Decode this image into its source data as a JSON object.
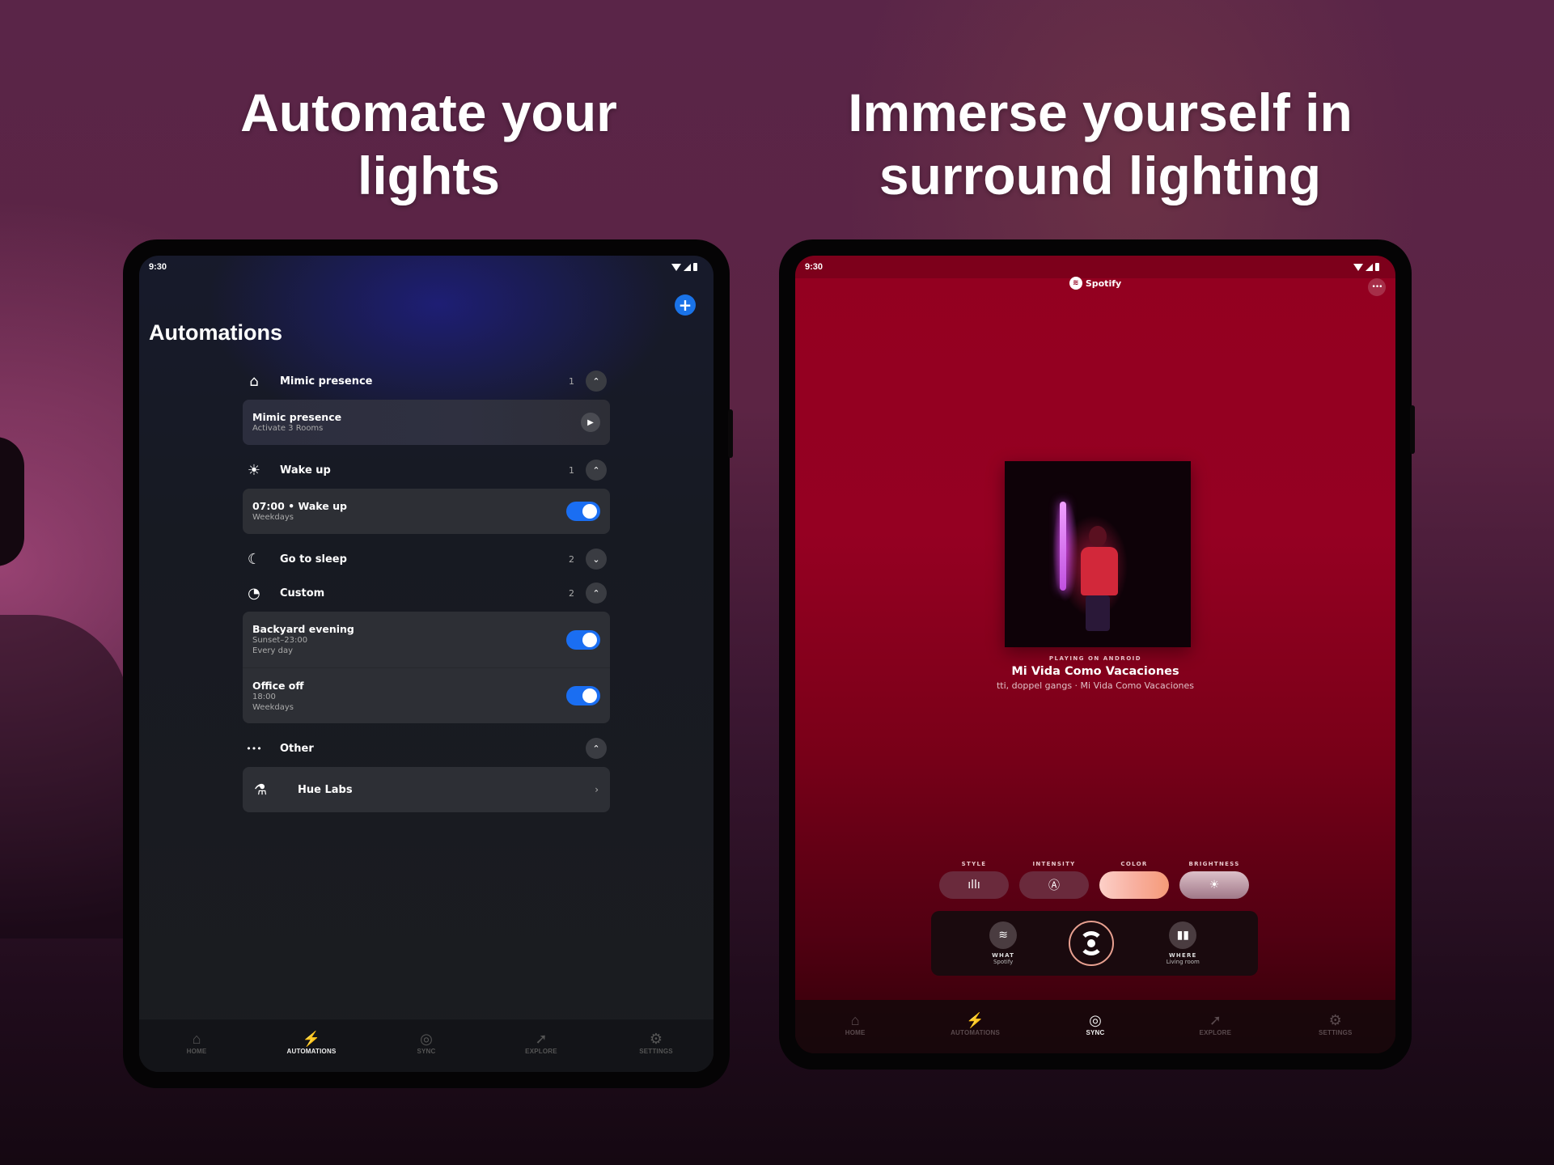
{
  "headlines": {
    "left": "Automate your lights",
    "right": "Immerse yourself in surround lighting"
  },
  "left_tablet": {
    "status": {
      "time": "9:30",
      "icons": [
        "wifi-icon",
        "signal-icon",
        "battery-icon"
      ]
    },
    "add_button": "+",
    "page_title": "Automations",
    "groups": [
      {
        "icon": "home-away-icon",
        "glyph": "⌂",
        "label": "Mimic presence",
        "count": "1",
        "expanded": true,
        "items": [
          {
            "title": "Mimic presence",
            "subtitle": [
              "Activate 3 Rooms"
            ],
            "control": "play"
          }
        ]
      },
      {
        "icon": "sunrise-icon",
        "glyph": "☀",
        "label": "Wake up",
        "count": "1",
        "expanded": true,
        "items": [
          {
            "title": "07:00 • Wake up",
            "subtitle": [
              "Weekdays"
            ],
            "control": "toggle",
            "on": true
          }
        ]
      },
      {
        "icon": "moon-sleep-icon",
        "glyph": "☾",
        "label": "Go to sleep",
        "count": "2",
        "expanded": false,
        "items": []
      },
      {
        "icon": "clock-icon",
        "glyph": "◔",
        "label": "Custom",
        "count": "2",
        "expanded": true,
        "items": [
          {
            "title": "Backyard evening",
            "subtitle": [
              "Sunset–23:00",
              "Every day"
            ],
            "control": "toggle",
            "on": true
          },
          {
            "title": "Office off",
            "subtitle": [
              "18:00",
              "Weekdays"
            ],
            "control": "toggle",
            "on": true
          }
        ]
      },
      {
        "icon": "more-dots-icon",
        "glyph": "•••",
        "label": "Other",
        "count": "",
        "expanded": true,
        "items": [
          {
            "title": "Hue Labs",
            "icon": "flask-icon",
            "control": "chevron"
          }
        ]
      }
    ],
    "chevron_up": "⌃",
    "chevron_down": "⌄",
    "play_glyph": "▶",
    "right_chevron": "›",
    "tabs": [
      {
        "label": "HOME",
        "icon": "home-icon",
        "glyph": "⌂",
        "active": false
      },
      {
        "label": "AUTOMATIONS",
        "icon": "lightning-icon",
        "glyph": "⚡",
        "active": true
      },
      {
        "label": "SYNC",
        "icon": "sync-icon",
        "glyph": "◎",
        "active": false
      },
      {
        "label": "EXPLORE",
        "icon": "rocket-icon",
        "glyph": "➚",
        "active": false
      },
      {
        "label": "SETTINGS",
        "icon": "gear-icon",
        "glyph": "⚙",
        "active": false
      }
    ]
  },
  "right_tablet": {
    "status": {
      "time": "9:30",
      "icons": [
        "wifi-icon",
        "signal-icon",
        "battery-icon"
      ]
    },
    "source_logo": "Spotify",
    "more_glyph": "•••",
    "now_playing": {
      "label": "PLAYING ON ANDROID",
      "title": "Mi Vida Como Vacaciones",
      "artist_line": "tti, doppel gangs · Mi Vida Como Vacaciones"
    },
    "controls": [
      {
        "label": "STYLE",
        "icon": "waveform-icon",
        "glyph": "ıllı"
      },
      {
        "label": "INTENSITY",
        "icon": "intensity-auto-icon",
        "glyph": "Ⓐ"
      },
      {
        "label": "COLOR",
        "icon": "color-gradient",
        "glyph": ""
      },
      {
        "label": "BRIGHTNESS",
        "icon": "sun-icon",
        "glyph": "☀"
      }
    ],
    "sync_panel": {
      "what": {
        "label": "WHAT",
        "value": "Spotify",
        "icon": "spotify-icon",
        "glyph": "≋"
      },
      "where": {
        "label": "WHERE",
        "value": "Living room",
        "icon": "lamps-icon",
        "glyph": "▮▮"
      }
    },
    "colors": {
      "accent_gradient": [
        "#fcd0c8",
        "#f59a78"
      ],
      "background": "#930020"
    },
    "tabs": [
      {
        "label": "HOME",
        "icon": "home-icon",
        "glyph": "⌂",
        "active": false
      },
      {
        "label": "AUTOMATIONS",
        "icon": "lightning-icon",
        "glyph": "⚡",
        "active": false
      },
      {
        "label": "SYNC",
        "icon": "sync-icon",
        "glyph": "◎",
        "active": true
      },
      {
        "label": "EXPLORE",
        "icon": "rocket-icon",
        "glyph": "➚",
        "active": false
      },
      {
        "label": "SETTINGS",
        "icon": "gear-icon",
        "glyph": "⚙",
        "active": false
      }
    ]
  }
}
